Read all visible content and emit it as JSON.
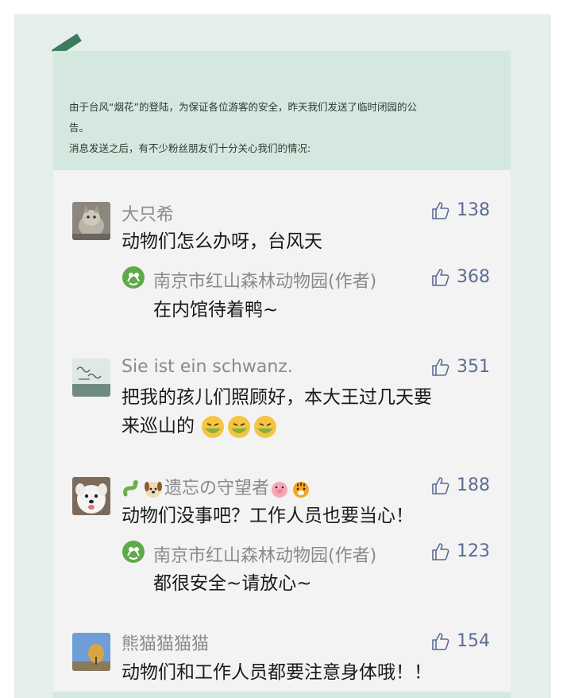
{
  "notice": {
    "line1": "由于台风“烟花”的登陆，为保证各位游客的安全，昨天我们发送了临时闭园的公",
    "line2": "告。",
    "line3": "消息发送之后，有不少粉丝朋友们十分关心我们的情况:"
  },
  "comments": [
    {
      "author": "大只希",
      "likes": "138",
      "text": "动物们怎么办呀，台风天",
      "reply": {
        "author": "南京市红山森林动物园(作者)",
        "likes": "368",
        "text": "在内馆待着鸭~"
      }
    },
    {
      "author": "Sie ist ein schwanz.",
      "likes": "351",
      "text_line1": "把我的孩儿们照顾好，本大王过几天要",
      "text_line2": "来巡山的"
    },
    {
      "author": "遗忘の守望者",
      "likes": "188",
      "text": "动物们没事吧？工作人员也要当心！",
      "reply": {
        "author": "南京市红山森林动物园(作者)",
        "likes": "123",
        "text": "都很安全~请放心~"
      }
    },
    {
      "author": "熊猫猫猫猫",
      "likes": "154",
      "text": "动物们和工作人员都要注意身体哦！！"
    }
  ],
  "colors": {
    "accent": "#3c7b5c",
    "like": "#5b6d92",
    "notice_bg": "#d4e8df",
    "comments_bg": "#f3f3f3"
  }
}
